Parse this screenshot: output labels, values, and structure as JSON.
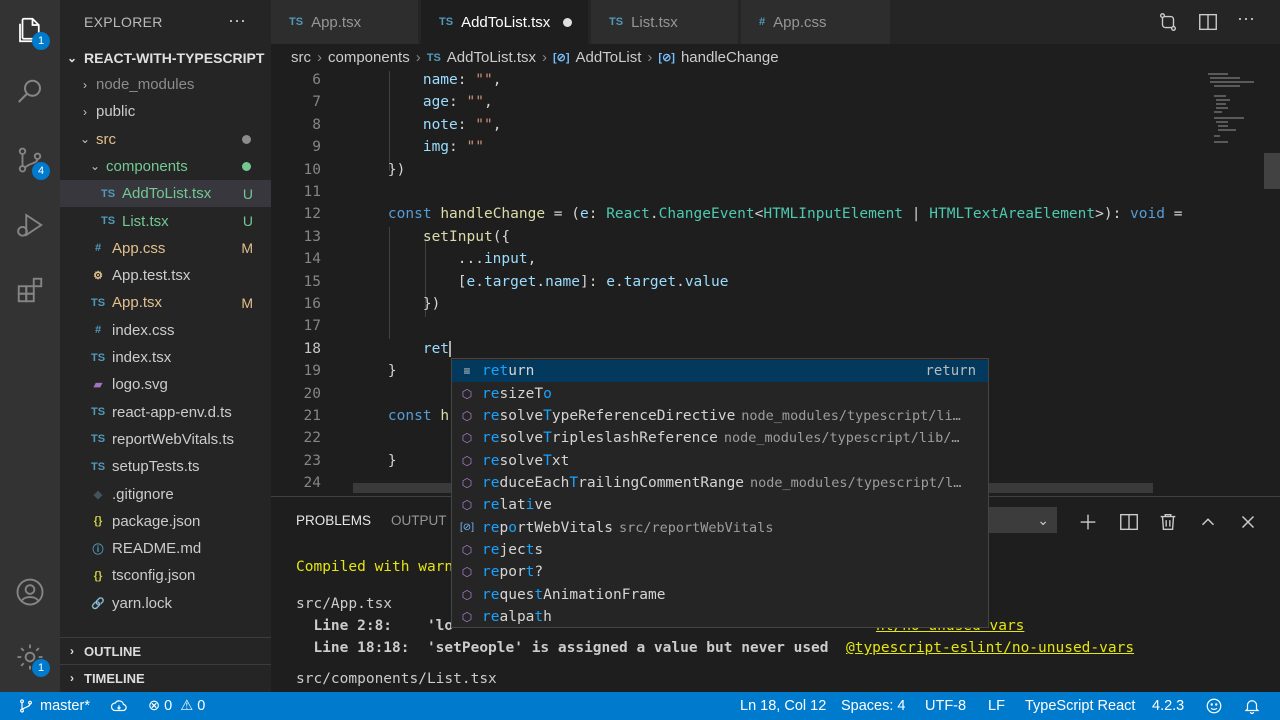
{
  "activity": {
    "explorer_badge": "1",
    "scm_badge": "4",
    "settings_badge": "1"
  },
  "sidebar": {
    "title": "EXPLORER",
    "root": "REACT-WITH-TYPESCRIPT",
    "items": [
      {
        "label": "node_modules",
        "kind": "folder",
        "status": "",
        "color": "#8c8c8c"
      },
      {
        "label": "public",
        "kind": "folder",
        "status": "",
        "color": "#cccccc"
      },
      {
        "label": "src",
        "kind": "folder-open",
        "status": "dot",
        "dot_color": "#8c8c8c",
        "color": "#e2c08d"
      },
      {
        "label": "components",
        "kind": "folder-open",
        "status": "dot",
        "dot_color": "#73c991",
        "color": "#73c991"
      },
      {
        "label": "AddToList.tsx",
        "kind": "ts",
        "status": "U",
        "color": "#73c991",
        "status_color": "#73c991"
      },
      {
        "label": "List.tsx",
        "kind": "ts",
        "status": "U",
        "color": "#73c991",
        "status_color": "#73c991"
      },
      {
        "label": "App.css",
        "kind": "css",
        "status": "M",
        "color": "#e2c08d",
        "status_color": "#e2c08d"
      },
      {
        "label": "App.test.tsx",
        "kind": "test",
        "status": "",
        "color": "#cccccc"
      },
      {
        "label": "App.tsx",
        "kind": "ts",
        "status": "M",
        "color": "#e2c08d",
        "status_color": "#e2c08d"
      },
      {
        "label": "index.css",
        "kind": "css",
        "status": "",
        "color": "#cccccc"
      },
      {
        "label": "index.tsx",
        "kind": "ts",
        "status": "",
        "color": "#cccccc"
      },
      {
        "label": "logo.svg",
        "kind": "svg",
        "status": "",
        "color": "#cccccc"
      },
      {
        "label": "react-app-env.d.ts",
        "kind": "ts",
        "status": "",
        "color": "#cccccc"
      },
      {
        "label": "reportWebVitals.ts",
        "kind": "ts",
        "status": "",
        "color": "#cccccc"
      },
      {
        "label": "setupTests.ts",
        "kind": "ts",
        "status": "",
        "color": "#cccccc"
      },
      {
        "label": ".gitignore",
        "kind": "git",
        "status": "",
        "color": "#cccccc"
      },
      {
        "label": "package.json",
        "kind": "json",
        "status": "",
        "color": "#cccccc"
      },
      {
        "label": "README.md",
        "kind": "info",
        "status": "",
        "color": "#cccccc"
      },
      {
        "label": "tsconfig.json",
        "kind": "json",
        "status": "",
        "color": "#cccccc"
      },
      {
        "label": "yarn.lock",
        "kind": "yarn",
        "status": "",
        "color": "#cccccc"
      }
    ],
    "outline": "OUTLINE",
    "timeline": "TIMELINE"
  },
  "tabs": [
    {
      "label": "App.tsx",
      "icon": "TS",
      "active": false
    },
    {
      "label": "AddToList.tsx",
      "icon": "TS",
      "active": true,
      "modified": true
    },
    {
      "label": "List.tsx",
      "icon": "TS",
      "active": false
    },
    {
      "label": "App.css",
      "icon": "#",
      "active": false
    }
  ],
  "breadcrumb": [
    "src",
    "components",
    "AddToList.tsx",
    "AddToList",
    "handleChange"
  ],
  "editor": {
    "line_numbers": [
      "6",
      "7",
      "8",
      "9",
      "10",
      "11",
      "12",
      "13",
      "14",
      "15",
      "16",
      "17",
      "18",
      "19",
      "20",
      "21",
      "22",
      "23",
      "24"
    ],
    "current_line": "18"
  },
  "suggest": {
    "items": [
      {
        "label": "return",
        "match": [
          0,
          3
        ],
        "detail": "",
        "right": "return",
        "icon": "keyword"
      },
      {
        "label": "resizeTo",
        "detail": "",
        "icon": "cube"
      },
      {
        "label": "resolveTypeReferenceDirective",
        "detail": "node_modules/typescript/li…",
        "icon": "cube"
      },
      {
        "label": "resolveTripleslashReference",
        "detail": "node_modules/typescript/lib/…",
        "icon": "cube"
      },
      {
        "label": "resolveTxt",
        "detail": "",
        "icon": "cube"
      },
      {
        "label": "reduceEachTrailingCommentRange",
        "detail": "node_modules/typescript/l…",
        "icon": "cube"
      },
      {
        "label": "relative",
        "detail": "",
        "icon": "cube"
      },
      {
        "label": "reportWebVitals",
        "detail": "src/reportWebVitals",
        "icon": "module"
      },
      {
        "label": "rejects",
        "detail": "",
        "icon": "cube"
      },
      {
        "label": "report?",
        "detail": "",
        "icon": "cube-outline"
      },
      {
        "label": "requestAnimationFrame",
        "detail": "",
        "icon": "cube"
      },
      {
        "label": "realpath",
        "detail": "",
        "icon": "cube"
      }
    ]
  },
  "panel": {
    "tabs": [
      "PROBLEMS",
      "OUTPUT"
    ],
    "lines": [
      "Compiled with warn",
      "",
      "src/App.tsx",
      "  Line 2:8:    'lo",
      "  Line 18:18:  'setPeople' is assigned a value but never used  ",
      "",
      "src/components/List.tsx"
    ],
    "rule_partial": "nt/no-unused-vars",
    "rule_full": "@typescript-eslint/no-unused-vars"
  },
  "status": {
    "branch": "master*",
    "errors": "0",
    "warnings": "0",
    "position": "Ln 18, Col 12",
    "spaces": "Spaces: 4",
    "encoding": "UTF-8",
    "eol": "LF",
    "language": "TypeScript React",
    "version": "4.2.3"
  }
}
